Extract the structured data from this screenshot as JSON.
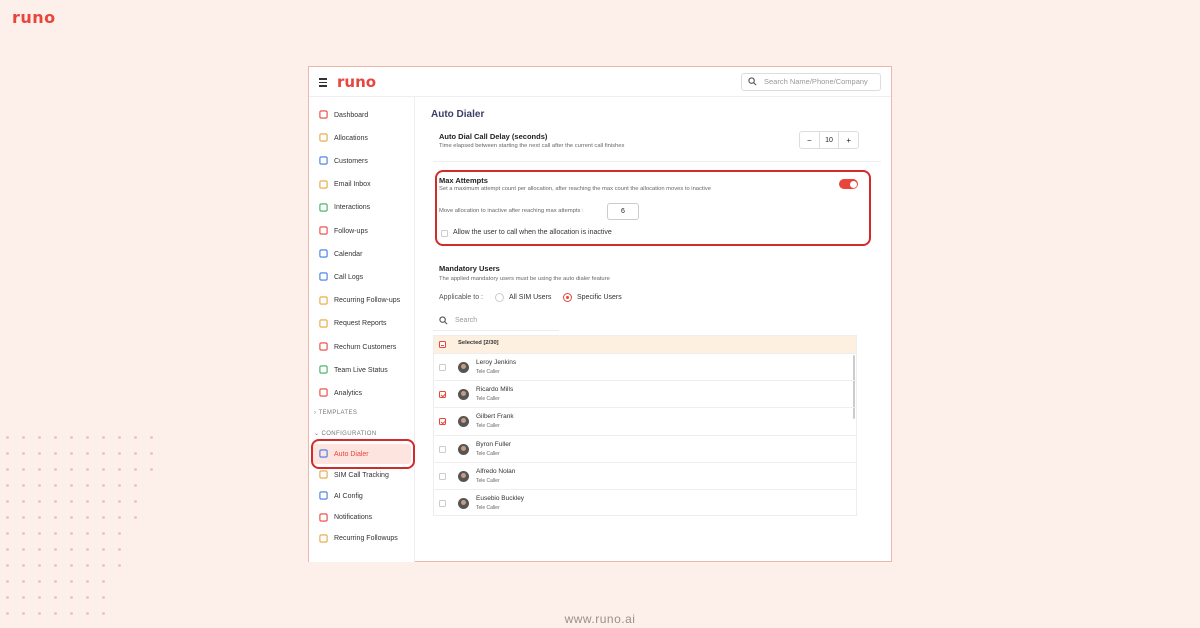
{
  "brand": {
    "name": "runo",
    "footer_url": "www.runo.ai",
    "accent": "#e8453c"
  },
  "header": {
    "logo": "runo",
    "search_placeholder": "Search Name/Phone/Company"
  },
  "sidebar": {
    "items": [
      {
        "label": "Dashboard",
        "icon": "grid-icon"
      },
      {
        "label": "Allocations",
        "icon": "allocation-icon"
      },
      {
        "label": "Customers",
        "icon": "users-icon"
      },
      {
        "label": "Email Inbox",
        "icon": "mail-icon"
      },
      {
        "label": "Interactions",
        "icon": "interactions-icon"
      },
      {
        "label": "Follow-ups",
        "icon": "calendar-check-icon"
      },
      {
        "label": "Calendar",
        "icon": "calendar-icon"
      },
      {
        "label": "Call Logs",
        "icon": "phone-icon"
      },
      {
        "label": "Recurring Follow-ups",
        "icon": "recurring-icon"
      },
      {
        "label": "Request Reports",
        "icon": "report-icon"
      },
      {
        "label": "Rechurn Customers",
        "icon": "rechurn-icon"
      },
      {
        "label": "Team Live Status",
        "icon": "team-icon"
      },
      {
        "label": "Analytics",
        "icon": "bar-chart-icon"
      }
    ],
    "sections": {
      "templates": "TEMPLATES",
      "configuration": "CONFIGURATION"
    },
    "config_items": [
      {
        "label": "Auto Dialer",
        "icon": "phone-dialer-icon",
        "active": true
      },
      {
        "label": "SIM Call Tracking",
        "icon": "sim-icon"
      },
      {
        "label": "AI Config",
        "icon": "sparkle-icon"
      },
      {
        "label": "Notifications",
        "icon": "bell-icon"
      },
      {
        "label": "Recurring Followups",
        "icon": "recurring-icon"
      }
    ]
  },
  "main": {
    "title": "Auto Dialer",
    "delay": {
      "title": "Auto Dial Call Delay (seconds)",
      "desc": "Time elapsed between starting the next call after the current call finishes",
      "value": "10",
      "minus": "−",
      "plus": "+"
    },
    "max_attempts": {
      "title": "Max Attempts",
      "desc": "Set a maximum attempt count per allocation, after reaching the max count the allocation moves to inactive",
      "enabled": true,
      "move_label": "Move allocation to inactive after reaching max attempts :",
      "move_value": "6",
      "allow_label": "Allow the user to call when the allocation is inactive"
    },
    "mandatory": {
      "title": "Mandatory Users",
      "desc": "The applied mandatory users must be using the auto dialer feature",
      "applicable_label": "Applicable to :",
      "option_all": "All SIM Users",
      "option_specific": "Specific Users",
      "search_placeholder": "Search",
      "selected_label": "Selected [2/30]",
      "users": [
        {
          "name": "Leroy Jenkins",
          "role": "Tele Caller",
          "checked": false
        },
        {
          "name": "Ricardo Mills",
          "role": "Tele Caller",
          "checked": true
        },
        {
          "name": "Gilbert Frank",
          "role": "Tele Caller",
          "checked": true
        },
        {
          "name": "Byron Fuller",
          "role": "Tele Caller",
          "checked": false
        },
        {
          "name": "Alfredo Nolan",
          "role": "Tele Caller",
          "checked": false
        },
        {
          "name": "Eusebio Buckley",
          "role": "Tele Caller",
          "checked": false
        }
      ]
    }
  }
}
